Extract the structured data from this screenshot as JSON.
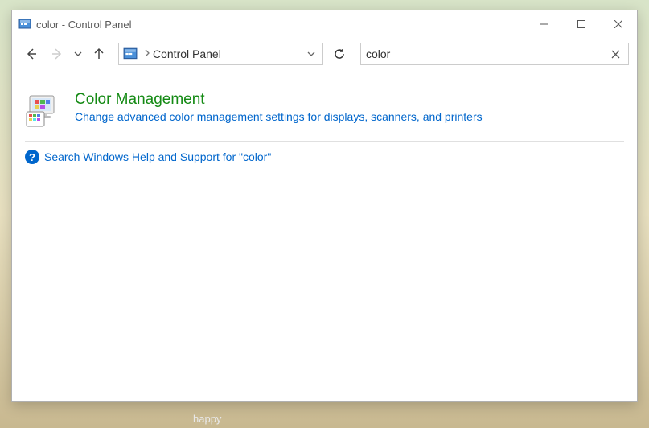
{
  "window": {
    "title": "color - Control Panel"
  },
  "address": {
    "location": "Control Panel"
  },
  "search": {
    "value": "color"
  },
  "result": {
    "title": "Color Management",
    "description": "Change advanced color management settings for displays, scanners, and printers"
  },
  "help": {
    "link_text": "Search Windows Help and Support for \"color\""
  },
  "stray": {
    "text": "happy"
  }
}
